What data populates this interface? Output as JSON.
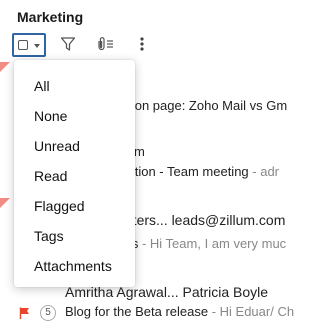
{
  "folder": {
    "title": "Marketing"
  },
  "toolbar": {
    "select_icon": "checkbox-dropdown-icon",
    "filter_icon": "filter-icon",
    "attachment_icon": "attachment-filter-icon",
    "more_icon": "more-vertical-icon"
  },
  "dropdown": {
    "items": [
      "All",
      "None",
      "Unread",
      "Read",
      "Flagged",
      "Tags",
      "Attachments"
    ]
  },
  "mails": [
    {
      "subject": "rison page: Zoho Mail vs Gm",
      "preview": ""
    },
    {
      "sender": "llum",
      "subject": "itation - Team meeting",
      "preview": " - adr"
    },
    {
      "sender": "utters... leads@zillum.com",
      "subject": "nts",
      "preview": " - Hi Team, I am very muc"
    },
    {
      "sender": "Amritha Agrawal... Patricia Boyle"
    },
    {
      "count": "5",
      "subject": "Blog for the Beta release",
      "preview": " - Hi Eduar/ Ch"
    }
  ],
  "colors": {
    "accent": "#2f65a3",
    "flag": "#e8452c",
    "unread_marker": "#f28b82"
  }
}
